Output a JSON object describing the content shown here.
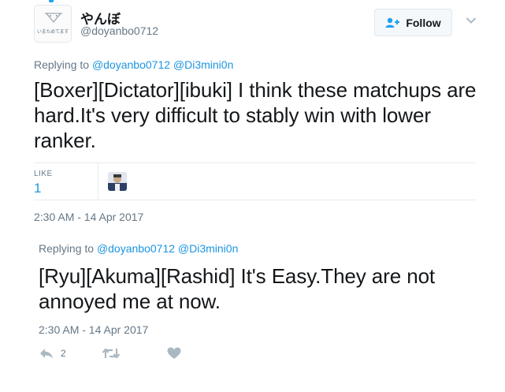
{
  "tweet": {
    "author": {
      "name": "やんぼ",
      "handle": "@doyanbo0712",
      "avatar_text": "いまためてます"
    },
    "follow_label": "Follow",
    "replying_prefix": "Replying to",
    "replying_mentions": [
      "@doyanbo0712",
      "@Di3mini0n"
    ],
    "text": "[Boxer][Dictator][ibuki] I think these matchups are hard.It's very difficult to stably win with lower ranker.",
    "likes_label": "LIKE",
    "likes_count": "1",
    "timestamp": "2:30 AM - 14 Apr 2017"
  },
  "reply": {
    "replying_prefix": "Replying to",
    "replying_mentions": [
      "@doyanbo0712",
      "@Di3mini0n"
    ],
    "text": "[Ryu][Akuma][Rashid] It's Easy.They are not annoyed me at now.",
    "timestamp": "2:30 AM - 14 Apr 2017",
    "actions": {
      "reply_icon": "reply-icon",
      "reply_count": "2",
      "retweet_icon": "retweet-icon",
      "like_icon": "heart-icon"
    }
  },
  "colors": {
    "link": "#1b95e0",
    "secondary_text": "#657786",
    "primary_text": "#14171a",
    "border": "#e6ecf0"
  }
}
